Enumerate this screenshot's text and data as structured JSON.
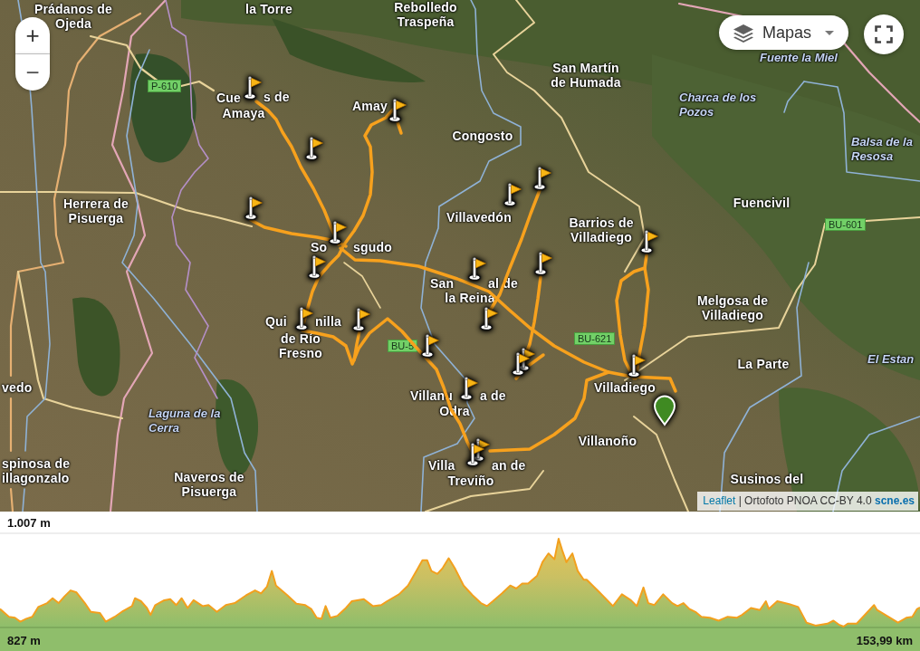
{
  "map": {
    "zoom_control": {
      "zoom_in": "+",
      "zoom_out": "−"
    },
    "layers_button": {
      "label": "Mapas"
    },
    "place_labels": [
      {
        "kind": "town",
        "lines": [
          "Prádanos de",
          "Ojeda"
        ]
      },
      {
        "kind": "town",
        "lines": [
          "la Torre"
        ]
      },
      {
        "kind": "town",
        "lines": [
          "Rebolledo",
          "Traspeña"
        ]
      },
      {
        "kind": "town",
        "lines": [
          "San Martín",
          "de Humada"
        ]
      },
      {
        "kind": "water",
        "lines": [
          "Fuente la Miel"
        ]
      },
      {
        "kind": "town",
        "lines": [
          "Cue"
        ]
      },
      {
        "kind": "town",
        "lines": [
          "s de"
        ]
      },
      {
        "kind": "town",
        "lines": [
          "Amaya"
        ]
      },
      {
        "kind": "town",
        "lines": [
          "Amay"
        ]
      },
      {
        "kind": "water",
        "lines": [
          "Charca de los",
          "Pozos"
        ]
      },
      {
        "kind": "town",
        "lines": [
          "Congosto"
        ]
      },
      {
        "kind": "water",
        "lines": [
          "Balsa de la",
          "Resosa"
        ]
      },
      {
        "kind": "town",
        "lines": [
          "Herrera de",
          "Pisuerga"
        ]
      },
      {
        "kind": "town",
        "lines": [
          "Villavedón"
        ]
      },
      {
        "kind": "town",
        "lines": [
          "So"
        ]
      },
      {
        "kind": "town",
        "lines": [
          "sgudo"
        ]
      },
      {
        "kind": "town",
        "lines": [
          "Barrios de",
          "Villadiego"
        ]
      },
      {
        "kind": "town",
        "lines": [
          "Fuencivil"
        ]
      },
      {
        "kind": "town",
        "lines": [
          "San"
        ]
      },
      {
        "kind": "town",
        "lines": [
          "al de"
        ]
      },
      {
        "kind": "town",
        "lines": [
          "la Reina"
        ]
      },
      {
        "kind": "town",
        "lines": [
          "Qui"
        ]
      },
      {
        "kind": "town",
        "lines": [
          "nilla"
        ]
      },
      {
        "kind": "town",
        "lines": [
          "Melgosa de",
          "Villadiego"
        ]
      },
      {
        "kind": "town",
        "lines": [
          "de Río",
          "Fresno"
        ]
      },
      {
        "kind": "town",
        "lines": [
          "La Parte"
        ]
      },
      {
        "kind": "water",
        "lines": [
          "El Estan"
        ]
      },
      {
        "kind": "town",
        "lines": [
          "vedo"
        ]
      },
      {
        "kind": "town",
        "lines": [
          "Villanu"
        ]
      },
      {
        "kind": "town",
        "lines": [
          "a de"
        ]
      },
      {
        "kind": "town",
        "lines": [
          "Villadiego"
        ]
      },
      {
        "kind": "water",
        "lines": [
          "Laguna de la",
          "Cerra"
        ]
      },
      {
        "kind": "town",
        "lines": [
          "Odra"
        ]
      },
      {
        "kind": "town",
        "lines": [
          "Villanoño"
        ]
      },
      {
        "kind": "town",
        "lines": [
          "spinosa de",
          "illagonzalo"
        ]
      },
      {
        "kind": "town",
        "lines": [
          "Naveros de",
          "Pisuerga"
        ]
      },
      {
        "kind": "town",
        "lines": [
          "Villa"
        ]
      },
      {
        "kind": "town",
        "lines": [
          "an de"
        ]
      },
      {
        "kind": "town",
        "lines": [
          "Treviño"
        ]
      },
      {
        "kind": "town",
        "lines": [
          "Susinos del"
        ]
      }
    ],
    "road_labels": [
      "P-610",
      "BU-601",
      "BU-621",
      "BU-5"
    ],
    "markers": [
      {
        "kind": "flag"
      },
      {
        "kind": "flag"
      },
      {
        "kind": "flag"
      },
      {
        "kind": "flag"
      },
      {
        "kind": "flag"
      },
      {
        "kind": "flag"
      },
      {
        "kind": "flag"
      },
      {
        "kind": "flag"
      },
      {
        "kind": "flag"
      },
      {
        "kind": "flag"
      },
      {
        "kind": "flag"
      },
      {
        "kind": "flag"
      },
      {
        "kind": "flag"
      },
      {
        "kind": "flag"
      },
      {
        "kind": "flag"
      },
      {
        "kind": "flag"
      },
      {
        "kind": "flag"
      },
      {
        "kind": "flag"
      },
      {
        "kind": "flag"
      },
      {
        "kind": "flag"
      },
      {
        "kind": "flag"
      },
      {
        "kind": "pin"
      }
    ],
    "attribution": {
      "parts": [
        {
          "kind": "link",
          "text": "Leaflet",
          "bold": false
        },
        {
          "kind": "text",
          "text": "| Ortofoto PNOA CC-BY 4.0"
        },
        {
          "kind": "link",
          "text": "scne.es",
          "bold": true
        }
      ]
    }
  },
  "elevation_profile": {
    "max_elevation": "1.007 m",
    "min_elevation": "827 m",
    "distance": "153,99 km"
  }
}
